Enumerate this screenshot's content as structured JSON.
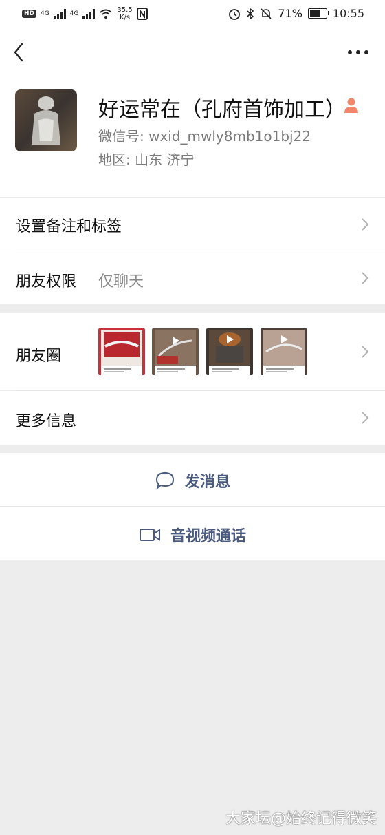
{
  "status_bar": {
    "hd": "HD",
    "net1": "4G",
    "net2": "4G",
    "speed_value": "35.5",
    "speed_unit": "K/s",
    "battery_percent": "71%",
    "battery_level": 0.71,
    "time": "10:55"
  },
  "nav": {
    "back_icon": "chevron-left-icon",
    "more_icon": "ellipsis-icon"
  },
  "profile": {
    "name": "好运常在（孔府首饰加工）",
    "wechat_id": "微信号: wxid_mwly8mb1o1bj22",
    "region": "地区:  山东  济宁",
    "person_icon_color": "#f0876a"
  },
  "rows": {
    "remark": {
      "label": "设置备注和标签"
    },
    "permission": {
      "label": "朋友权限",
      "value": "仅聊天"
    },
    "moments": {
      "label": "朋友圈"
    },
    "more_info": {
      "label": "更多信息"
    }
  },
  "actions": {
    "message": {
      "label": "发消息",
      "icon": "chat-bubble-icon"
    },
    "call": {
      "label": "音视频通话",
      "icon": "video-camera-icon"
    }
  },
  "colors": {
    "link_blue": "#4a5b7f",
    "background": "#ededed"
  },
  "watermark": "大家坛@始终记得微笑"
}
